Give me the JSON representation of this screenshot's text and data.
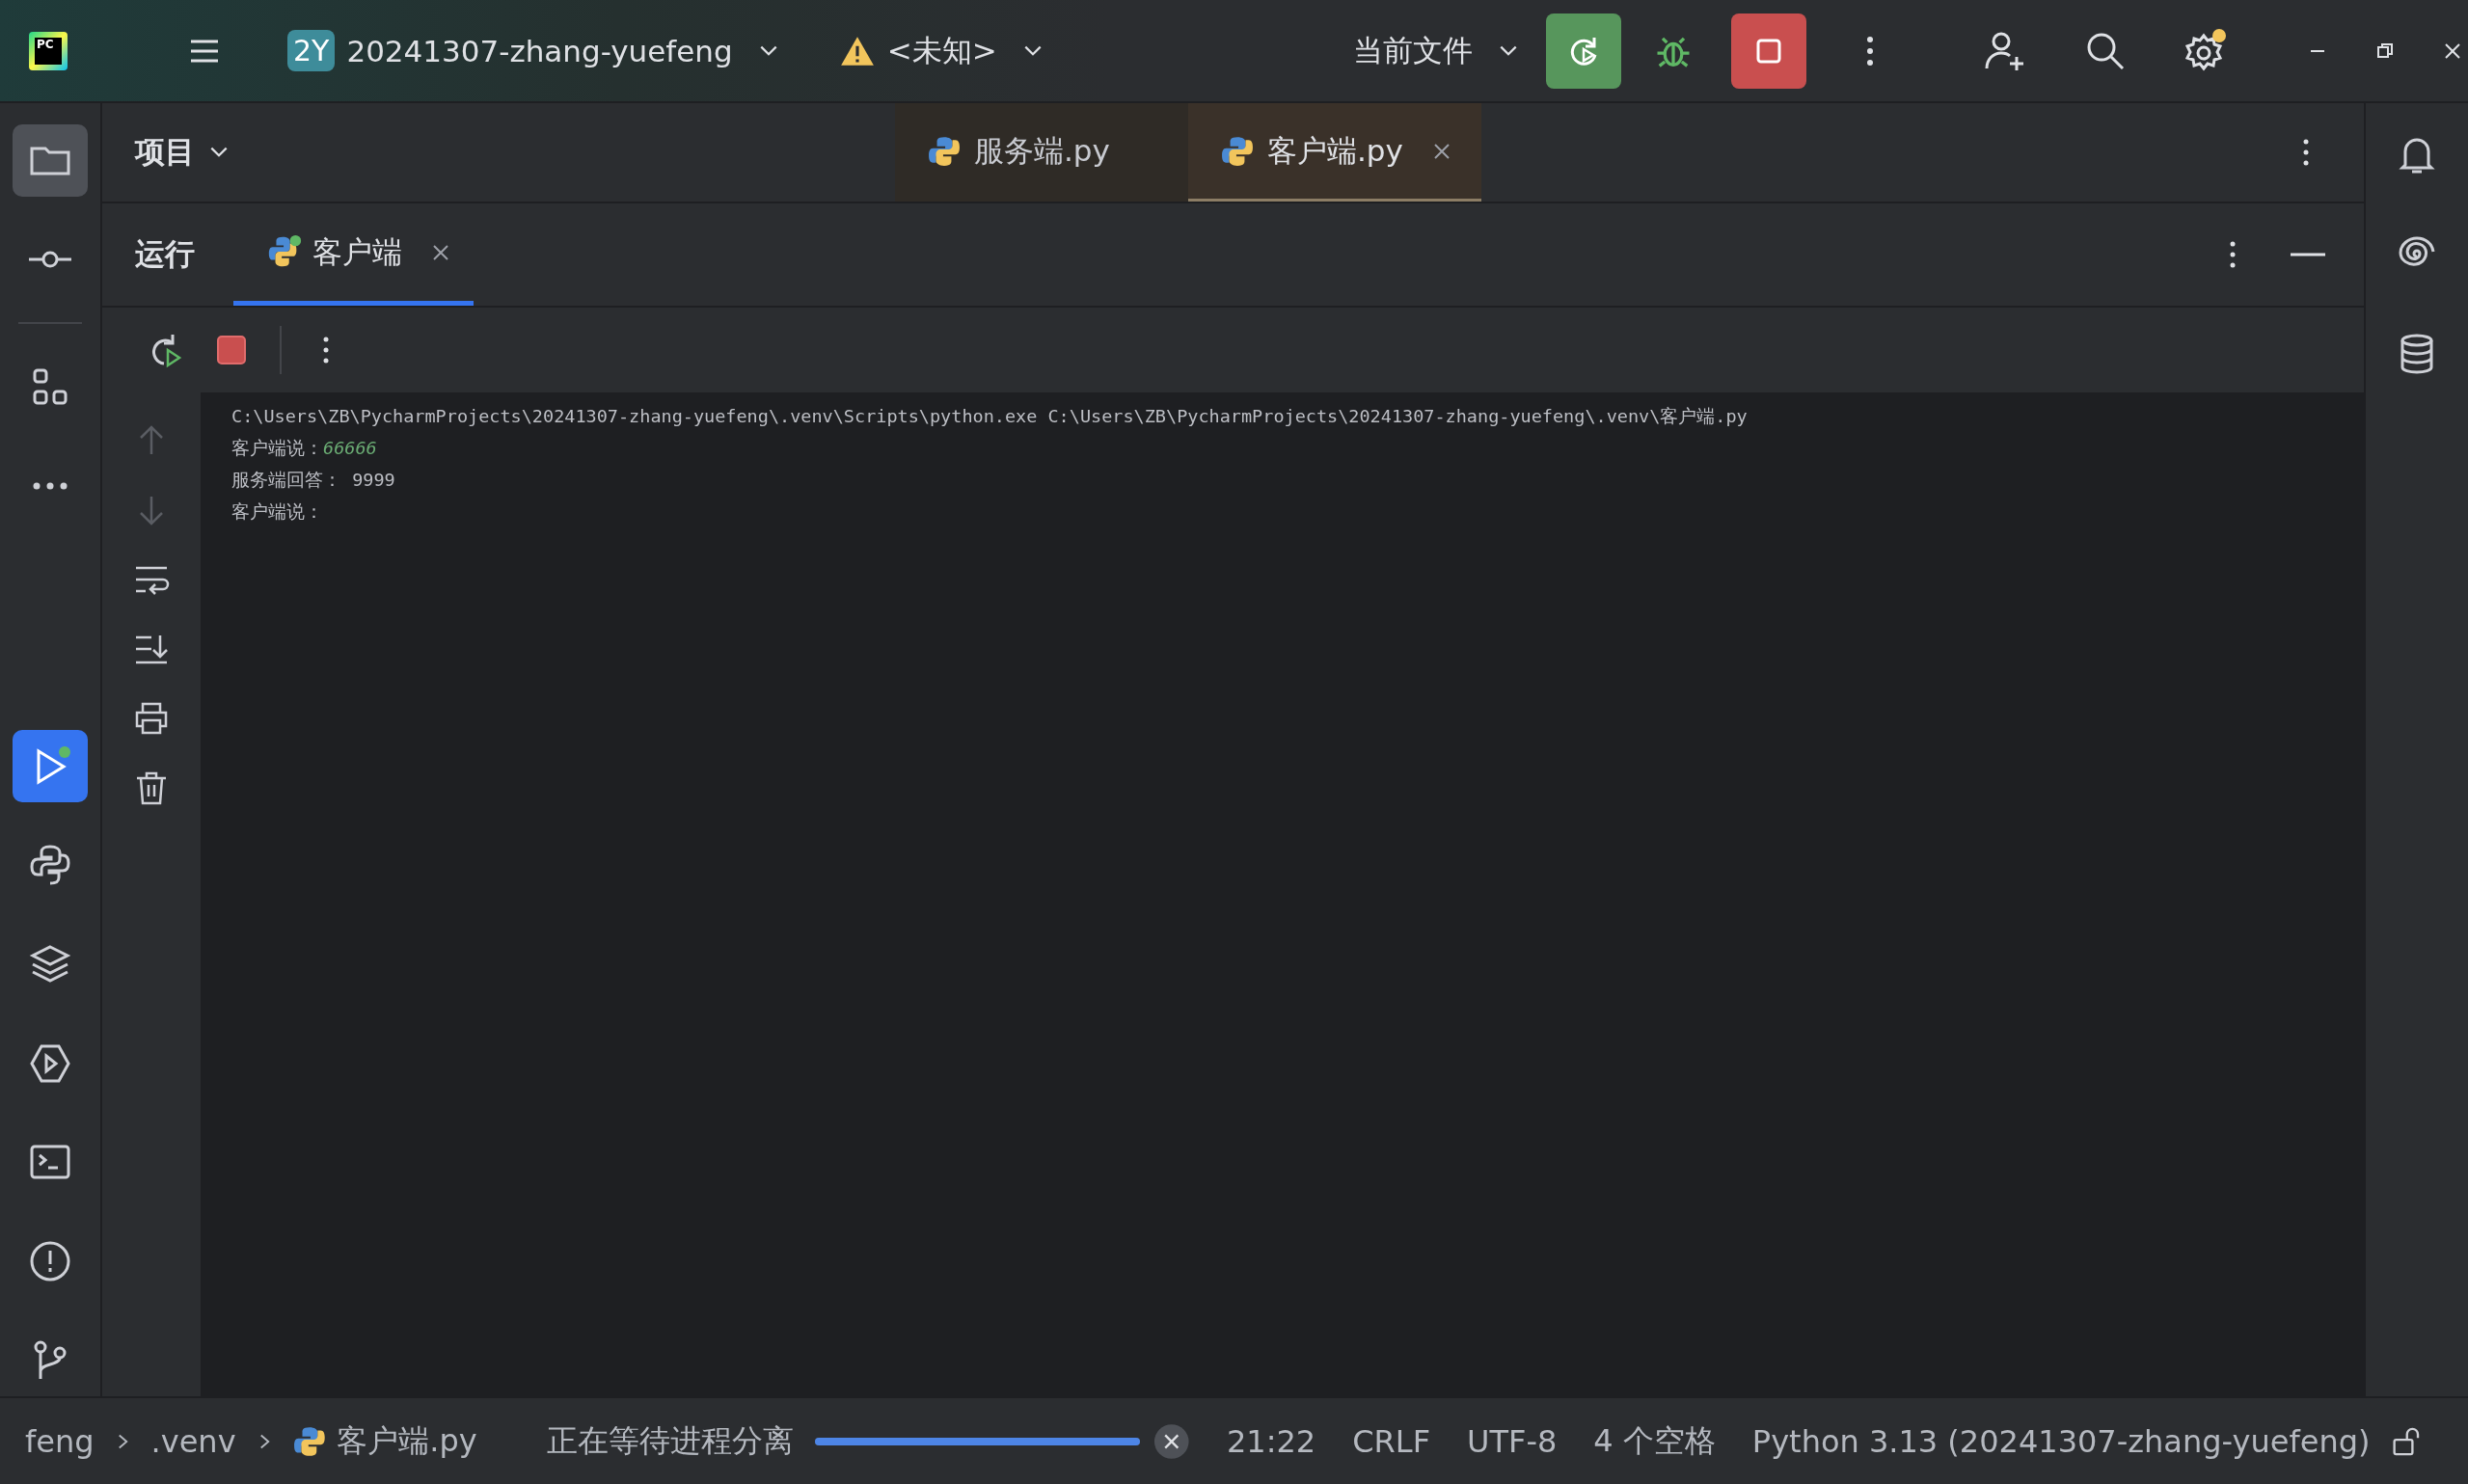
{
  "title_bar": {
    "logo": "PC",
    "project_badge": "2Y",
    "project": "20241307-zhang-yuefeng",
    "run_config": "<未知>",
    "current_file": "当前文件"
  },
  "project_panel": {
    "title": "项目"
  },
  "editor_tabs": [
    {
      "label": "服务端.py",
      "selected": false
    },
    {
      "label": "客户端.py",
      "selected": true
    }
  ],
  "left_toolbar": [
    {
      "kind": "folder",
      "selected": true
    },
    {
      "kind": "commit",
      "selected": false
    },
    {
      "kind": "structure",
      "selected": false
    },
    {
      "kind": "more",
      "selected": false
    },
    {
      "kind": "run",
      "selected": true
    },
    {
      "kind": "python",
      "selected": false
    },
    {
      "kind": "layers",
      "selected": false
    },
    {
      "kind": "services",
      "selected": false
    },
    {
      "kind": "terminal",
      "selected": false
    },
    {
      "kind": "problems",
      "selected": false
    },
    {
      "kind": "git",
      "selected": false
    }
  ],
  "run_panel": {
    "title": "运行",
    "tabs": [
      {
        "label": "客户端",
        "selected": true
      }
    ]
  },
  "console": {
    "lines": [
      {
        "kind": "plain",
        "text": "C:\\Users\\ZB\\PycharmProjects\\20241307-zhang-yuefeng\\.venv\\Scripts\\python.exe C:\\Users\\ZB\\PycharmProjects\\20241307-zhang-yuefeng\\.venv\\客户端.py"
      },
      {
        "kind": "input",
        "prompt": "客户端说：",
        "value": "66666"
      },
      {
        "kind": "plain",
        "text": "服务端回答： 9999"
      },
      {
        "kind": "plain",
        "text": "客户端说："
      }
    ]
  },
  "status_bar": {
    "breadcrumbs": [
      "feng",
      ".venv",
      "客户端.py"
    ],
    "task": "正在等待进程分离",
    "progress": {
      "level": 1
    },
    "position": "21:22",
    "line_separator": "CRLF",
    "encoding": "UTF-8",
    "indent": "4 个空格",
    "interpreter": "Python 3.13 (20241307-zhang-yuefeng)"
  }
}
